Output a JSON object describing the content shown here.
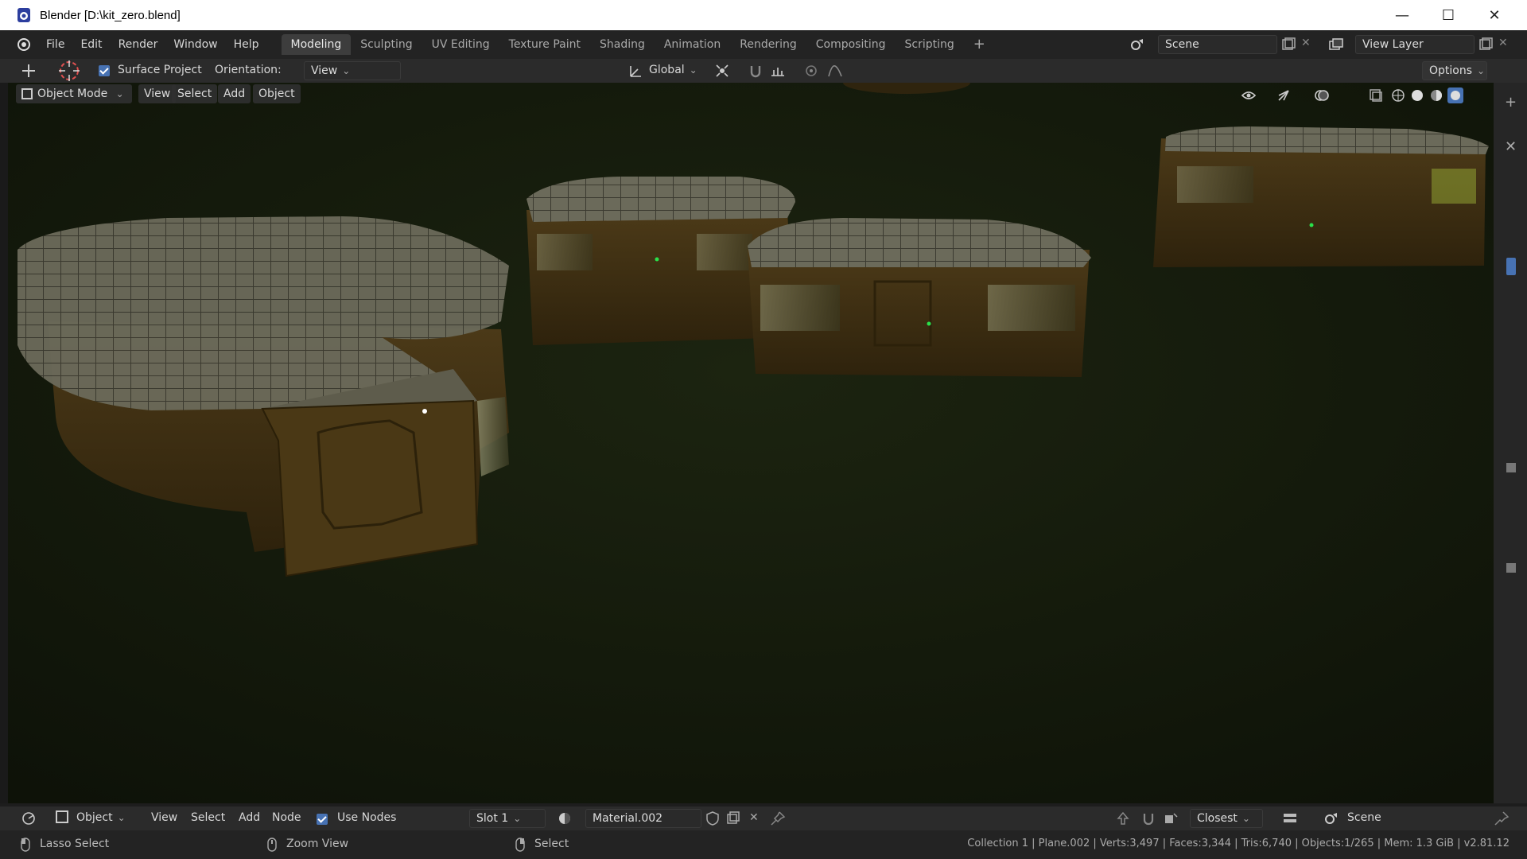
{
  "window": {
    "title": "Blender [D:\\kit_zero.blend]",
    "minimize": "—",
    "maximize": "☐",
    "close": "✕"
  },
  "menu": [
    "File",
    "Edit",
    "Render",
    "Window",
    "Help"
  ],
  "workspaces": [
    "Modeling",
    "Sculpting",
    "UV Editing",
    "Texture Paint",
    "Shading",
    "Animation",
    "Rendering",
    "Compositing",
    "Scripting"
  ],
  "workspace_add": "+",
  "scene": {
    "name": "Scene"
  },
  "view_layer": {
    "name": "View Layer"
  },
  "tool_settings": {
    "surface_project_label": "Surface Project",
    "orientation_label": "Orientation:",
    "orientation_value": "View",
    "transform_orientation": "Global",
    "options_label": "Options"
  },
  "viewport_header": {
    "mode": "Object Mode",
    "view": "View",
    "select": "Select",
    "add": "Add",
    "object": "Object"
  },
  "shader_header": {
    "editor_mode": "Object",
    "view": "View",
    "select": "Select",
    "add": "Add",
    "node": "Node",
    "use_nodes_label": "Use Nodes",
    "slot": "Slot 1",
    "material": "Material.002",
    "snap": "Closest",
    "scene": "Scene"
  },
  "status": {
    "left_hint": "Lasso Select",
    "mid_hint": "Zoom View",
    "right_hint": "Select",
    "stats": "Collection 1 | Plane.002 | Verts:3,497 | Faces:3,344 | Tris:6,740 | Objects:1/265 | Mem: 1.3 GiB | v2.81.12"
  },
  "colors": {
    "accent": "#4772b3",
    "active_tab": "#3d3d3d",
    "viewport_bg": "#10140a"
  }
}
